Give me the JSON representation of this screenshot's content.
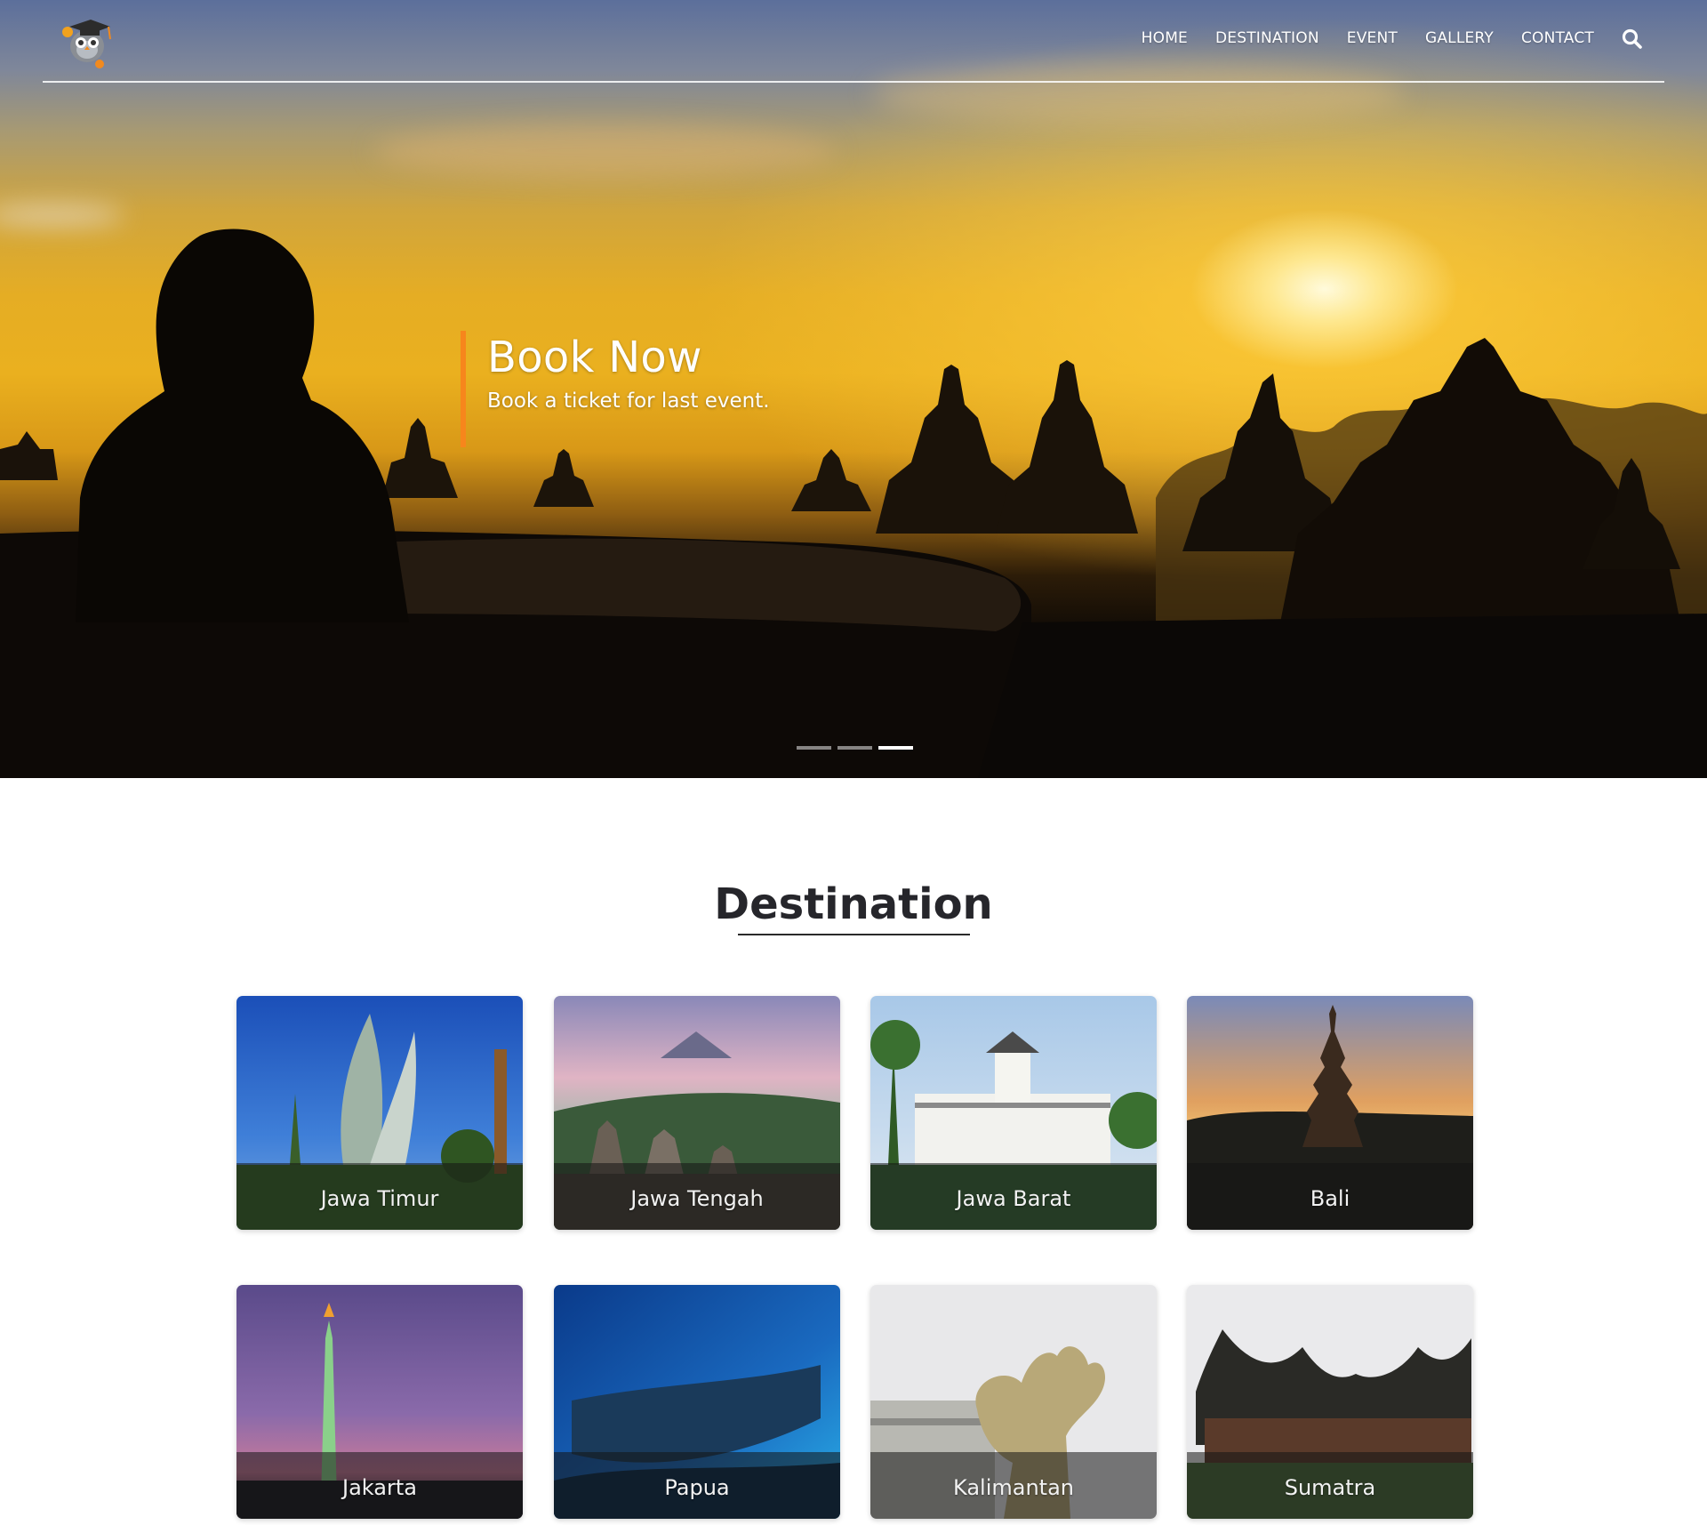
{
  "nav": {
    "items": [
      "HOME",
      "DESTINATION",
      "EVENT",
      "GALLERY",
      "CONTACT"
    ],
    "search_icon": "search-icon",
    "logo_icon": "owl-graduate-logo"
  },
  "hero": {
    "title": "Book Now",
    "subtitle": "Book a ticket for last event.",
    "slide_count": 3,
    "active_slide": 3
  },
  "destination": {
    "title": "Destination",
    "cards": [
      {
        "label": "Jawa Timur"
      },
      {
        "label": "Jawa Tengah"
      },
      {
        "label": "Jawa Barat"
      },
      {
        "label": "Bali"
      },
      {
        "label": "Jakarta"
      },
      {
        "label": "Papua"
      },
      {
        "label": "Kalimantan"
      },
      {
        "label": "Sumatra"
      }
    ]
  },
  "colors": {
    "accent": "#f7861c",
    "heading": "#26262b",
    "nav_text": "#ffffff"
  }
}
